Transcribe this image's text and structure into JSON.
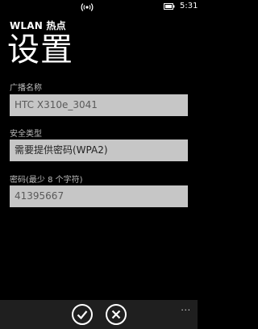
{
  "status_bar": {
    "clock": "5:31",
    "wifi_icon": "wifi-icon",
    "battery_icon": "battery-icon"
  },
  "header": {
    "app_title": "WLAN 热点",
    "page_title": "设置"
  },
  "form": {
    "broadcast_name": {
      "label": "广播名称",
      "value": "HTC X310e_3041"
    },
    "security_type": {
      "label": "安全类型",
      "value": "需要提供密码(WPA2)"
    },
    "password": {
      "label": "密码(最少 8 个字符)",
      "value": "41395667"
    }
  },
  "app_bar": {
    "confirm_icon": "check-icon",
    "cancel_icon": "close-icon",
    "more": "..."
  },
  "colors": {
    "background": "#000000",
    "field_background": "#c6c6c6",
    "app_bar_background": "#1f1f1f",
    "label": "#bdbdbd"
  }
}
